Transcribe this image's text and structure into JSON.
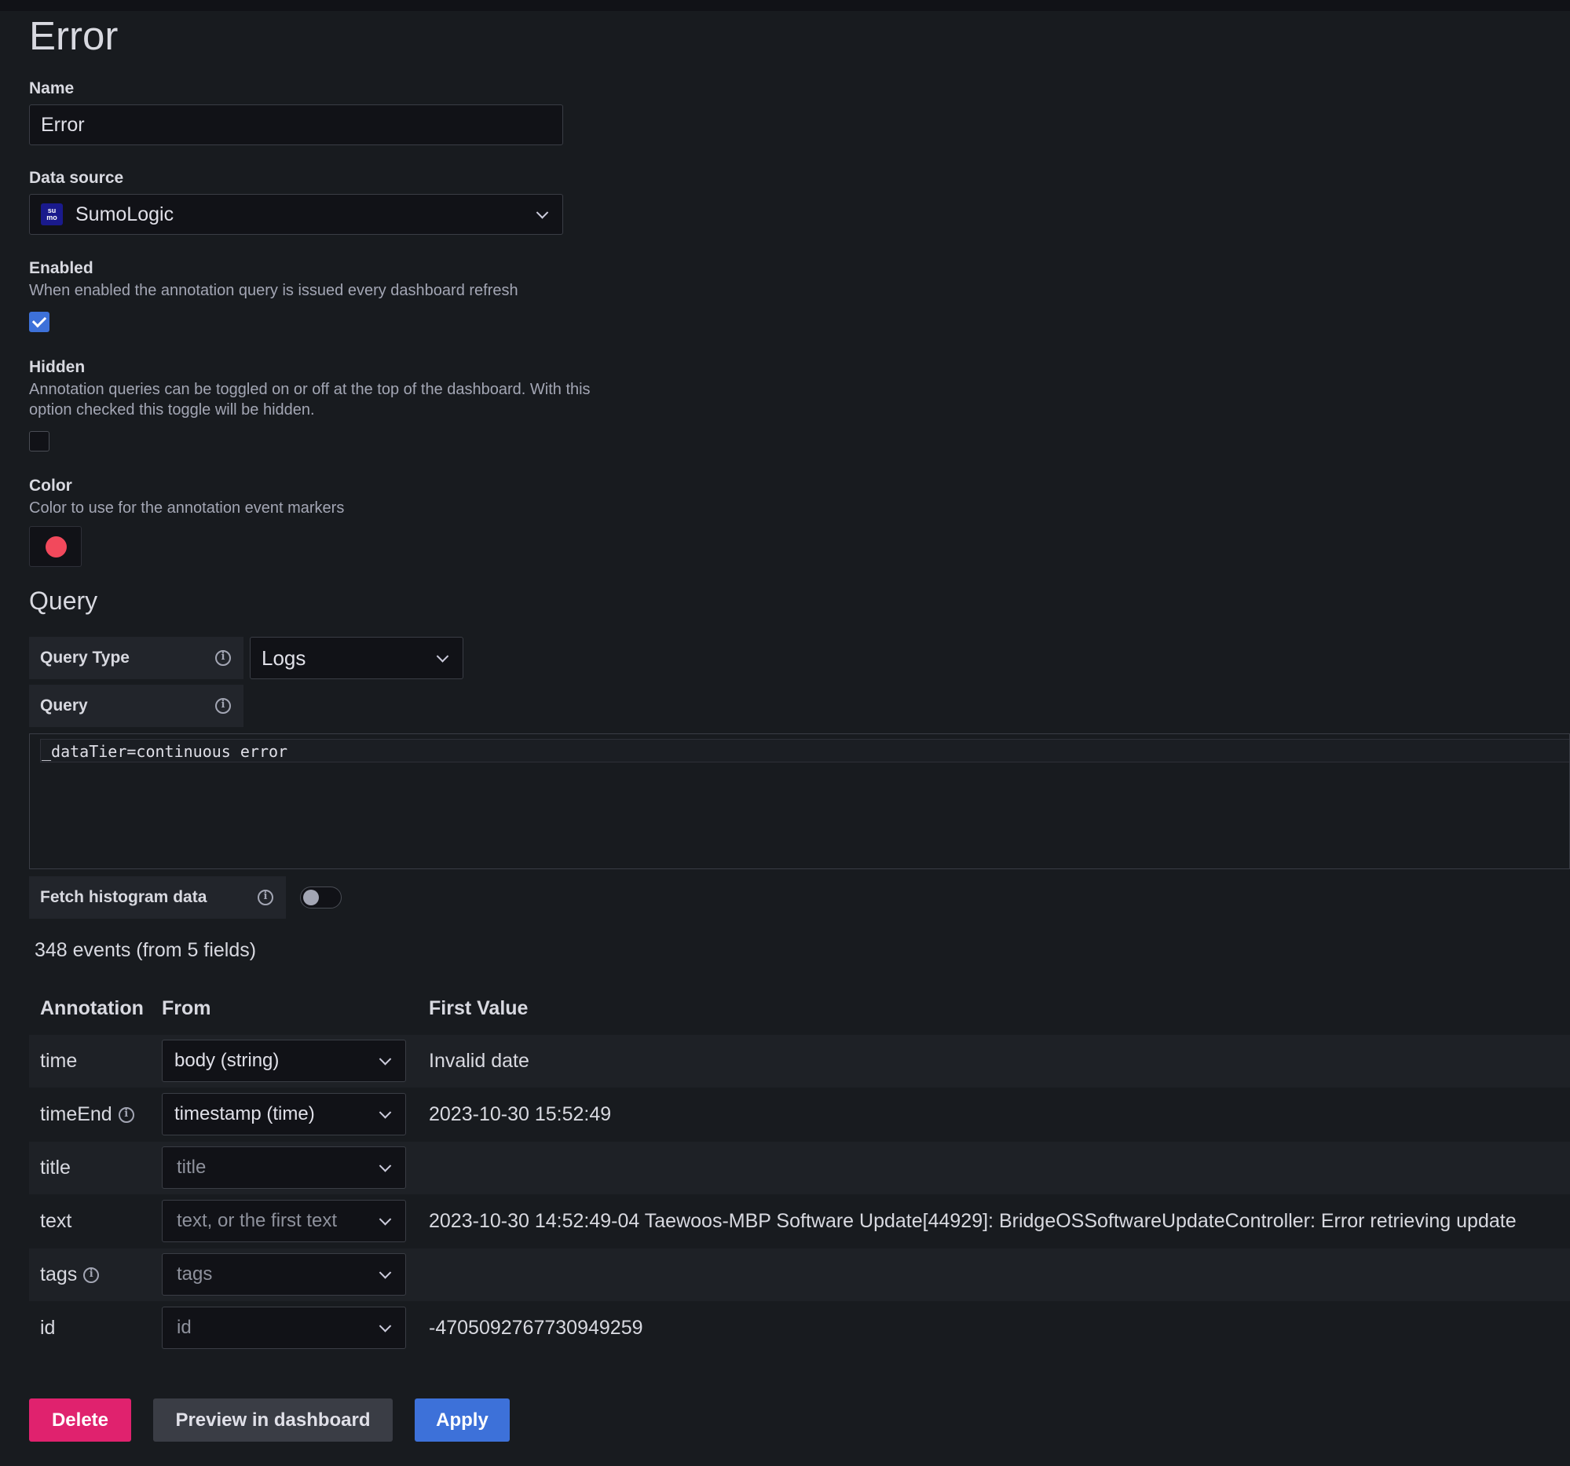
{
  "page": {
    "title": "Error"
  },
  "name_field": {
    "label": "Name",
    "value": "Error"
  },
  "data_source": {
    "label": "Data source",
    "selected": "SumoLogic",
    "icon": "sumologic-icon"
  },
  "enabled": {
    "label": "Enabled",
    "description": "When enabled the annotation query is issued every dashboard refresh",
    "checked": true
  },
  "hidden": {
    "label": "Hidden",
    "description_line1": "Annotation queries can be toggled on or off at the top of the dashboard. With this",
    "description_line2": "option checked this toggle will be hidden.",
    "checked": false
  },
  "color": {
    "label": "Color",
    "description": "Color to use for the annotation event markers",
    "value": "#f2495c"
  },
  "query_section": {
    "title": "Query",
    "query_type_label": "Query Type",
    "query_type_value": "Logs",
    "query_label": "Query",
    "query_text": "_dataTier=continuous error",
    "histogram_label": "Fetch histogram data",
    "histogram_enabled": false
  },
  "events_summary": "348 events (from 5 fields)",
  "mapping_table": {
    "headers": [
      "Annotation",
      "From",
      "First Value"
    ],
    "rows": [
      {
        "name": "time",
        "from": "body (string)",
        "from_is_placeholder": false,
        "value": "Invalid date"
      },
      {
        "name": "timeEnd",
        "from": "timestamp (time)",
        "from_is_placeholder": false,
        "value": "2023-10-30 15:52:49",
        "has_info": true
      },
      {
        "name": "title",
        "from": "title",
        "from_is_placeholder": true,
        "value": ""
      },
      {
        "name": "text",
        "from": "text, or the first text",
        "from_is_placeholder": true,
        "value": "2023-10-30 14:52:49-04 Taewoos-MBP Software Update[44929]: BridgeOSSoftwareUpdateController: Error retrieving update"
      },
      {
        "name": "tags",
        "from": "tags",
        "from_is_placeholder": true,
        "value": "",
        "has_info": true
      },
      {
        "name": "id",
        "from": "id",
        "from_is_placeholder": true,
        "value": "-4705092767730949259"
      }
    ]
  },
  "actions": {
    "delete": "Delete",
    "preview": "Preview in dashboard",
    "apply": "Apply"
  },
  "colors": {
    "accent": "#3d71d9",
    "danger": "#e0226e",
    "background": "#181b1f"
  }
}
